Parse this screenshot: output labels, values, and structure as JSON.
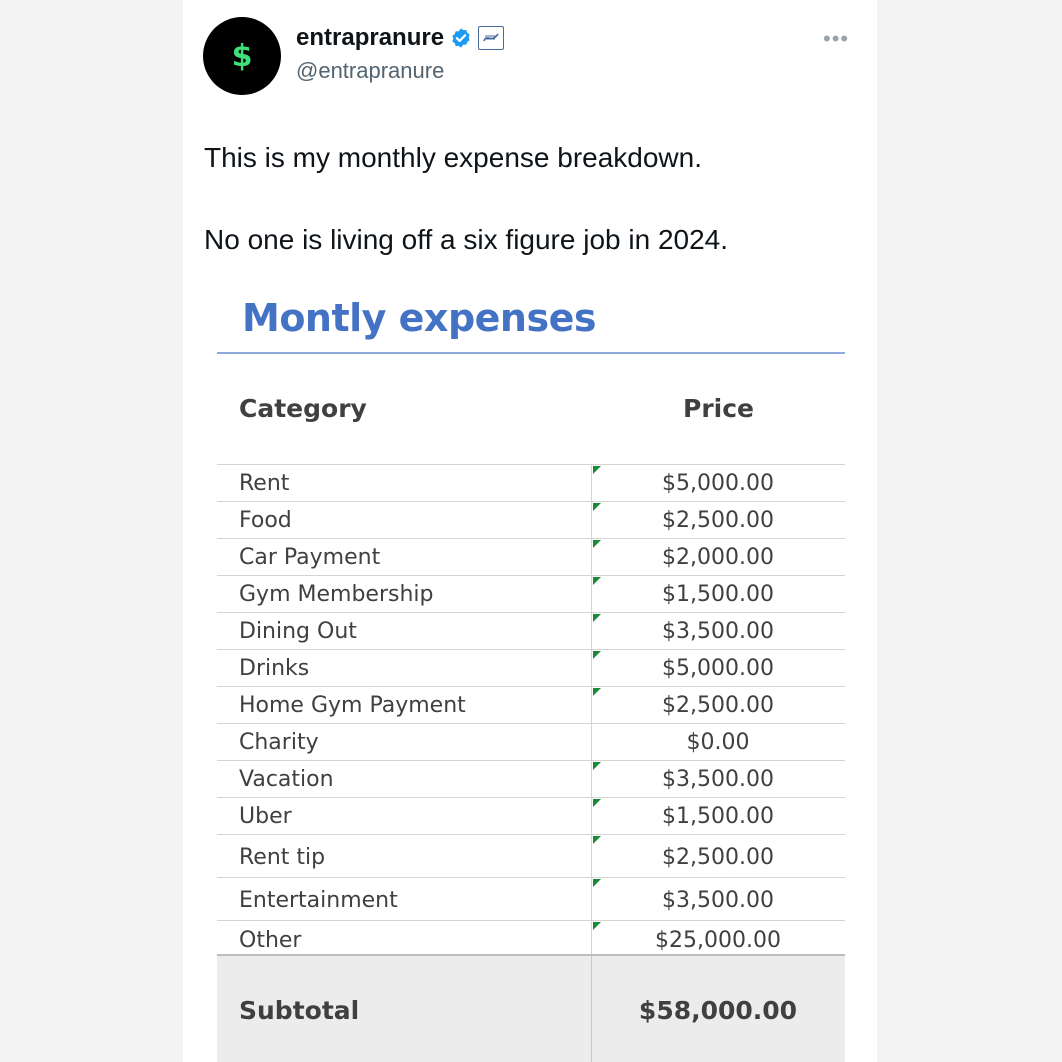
{
  "post": {
    "author": {
      "display_name": "entrapranure",
      "handle": "@entrapranure",
      "avatar_glyph": "$",
      "verified_badge": "verified-check-icon",
      "affiliate_badge": "affiliate-badge-icon"
    },
    "more_label": "•••",
    "text_lines": [
      "This is my monthly expense breakdown.",
      "No one is living off a six figure job in 2024."
    ]
  },
  "sheet": {
    "title": "Montly expenses",
    "headers": {
      "category": "Category",
      "price": "Price"
    },
    "rows": [
      {
        "category": "Rent",
        "price": "$5,000.00",
        "flag": true
      },
      {
        "category": "Food",
        "price": "$2,500.00",
        "flag": true
      },
      {
        "category": "Car Payment",
        "price": "$2,000.00",
        "flag": true
      },
      {
        "category": "Gym Membership",
        "price": "$1,500.00",
        "flag": true
      },
      {
        "category": "Dining Out",
        "price": "$3,500.00",
        "flag": true
      },
      {
        "category": "Drinks",
        "price": "$5,000.00",
        "flag": true
      },
      {
        "category": "Home Gym Payment",
        "price": "$2,500.00",
        "flag": true
      },
      {
        "category": "Charity",
        "price": "$0.00",
        "flag": false
      },
      {
        "category": "Vacation",
        "price": "$3,500.00",
        "flag": true
      },
      {
        "category": "Uber",
        "price": "$1,500.00",
        "flag": true
      },
      {
        "category": "Rent tip",
        "price": "$2,500.00",
        "flag": true
      },
      {
        "category": "Entertainment",
        "price": "$3,500.00",
        "flag": true
      },
      {
        "category": "Other",
        "price": "$25,000.00",
        "flag": true
      }
    ],
    "subtotal": {
      "label": "Subtotal",
      "value": "$58,000.00"
    }
  },
  "colors": {
    "verified_blue": "#1d9bf0",
    "title_blue": "#4472c4",
    "error_flag_green": "#1a8a3a",
    "avatar_dollar_green": "#3fe07a"
  }
}
